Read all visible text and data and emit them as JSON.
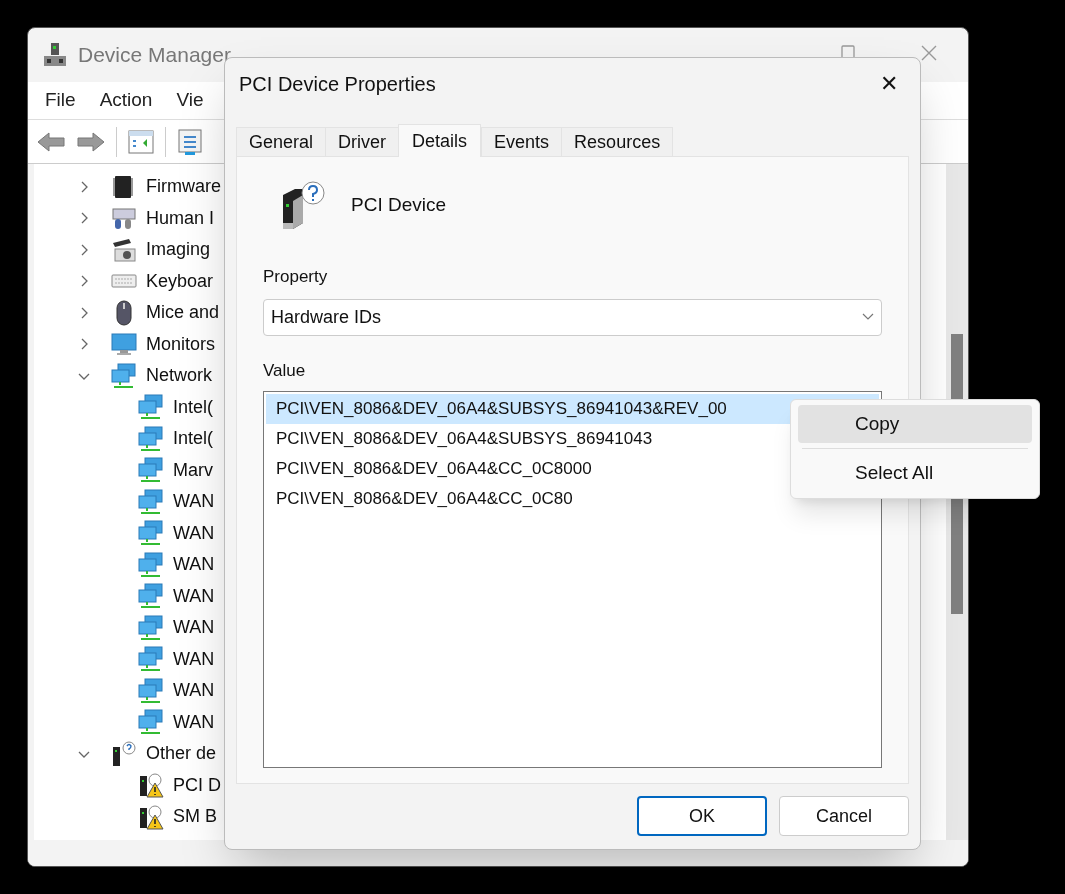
{
  "main_window": {
    "title": "Device Manager",
    "menu": [
      "File",
      "Action",
      "Vie"
    ],
    "tree": [
      {
        "label": "Firmware",
        "kind": "chip",
        "expanded": false
      },
      {
        "label": "Human I",
        "kind": "hid",
        "expanded": false
      },
      {
        "label": "Imaging",
        "kind": "camera",
        "expanded": false
      },
      {
        "label": "Keyboar",
        "kind": "keyboard",
        "expanded": false
      },
      {
        "label": "Mice and",
        "kind": "mouse",
        "expanded": false
      },
      {
        "label": "Monitors",
        "kind": "monitor",
        "expanded": false
      },
      {
        "label": "Network",
        "kind": "network",
        "expanded": true,
        "children": [
          {
            "label": "Intel(",
            "kind": "network"
          },
          {
            "label": "Intel(",
            "kind": "network"
          },
          {
            "label": "Marv",
            "kind": "network"
          },
          {
            "label": "WAN",
            "kind": "network"
          },
          {
            "label": "WAN",
            "kind": "network"
          },
          {
            "label": "WAN",
            "kind": "network"
          },
          {
            "label": "WAN",
            "kind": "network"
          },
          {
            "label": "WAN",
            "kind": "network"
          },
          {
            "label": "WAN",
            "kind": "network"
          },
          {
            "label": "WAN",
            "kind": "network"
          },
          {
            "label": "WAN",
            "kind": "network"
          }
        ]
      },
      {
        "label": "Other de",
        "kind": "unknown",
        "expanded": true,
        "children": [
          {
            "label": "PCI D",
            "kind": "warning"
          },
          {
            "label": "SM B",
            "kind": "warning"
          }
        ]
      }
    ]
  },
  "dialog": {
    "title": "PCI Device Properties",
    "close": "✕",
    "tabs": [
      {
        "label": "General",
        "selected": false
      },
      {
        "label": "Driver",
        "selected": false
      },
      {
        "label": "Details",
        "selected": true
      },
      {
        "label": "Events",
        "selected": false
      },
      {
        "label": "Resources",
        "selected": false
      }
    ],
    "device_name": "PCI Device",
    "property_label": "Property",
    "property_value": "Hardware IDs",
    "value_label": "Value",
    "values": [
      {
        "text": "PCI\\VEN_8086&DEV_06A4&SUBSYS_86941043&REV_00",
        "selected": true
      },
      {
        "text": "PCI\\VEN_8086&DEV_06A4&SUBSYS_86941043",
        "selected": false
      },
      {
        "text": "PCI\\VEN_8086&DEV_06A4&CC_0C8000",
        "selected": false
      },
      {
        "text": "PCI\\VEN_8086&DEV_06A4&CC_0C80",
        "selected": false
      }
    ],
    "buttons": [
      {
        "label": "OK",
        "default": true
      },
      {
        "label": "Cancel",
        "default": false
      }
    ]
  },
  "context_menu": [
    {
      "label": "Copy",
      "selected": true
    },
    {
      "label": "Select All",
      "selected": false
    }
  ]
}
